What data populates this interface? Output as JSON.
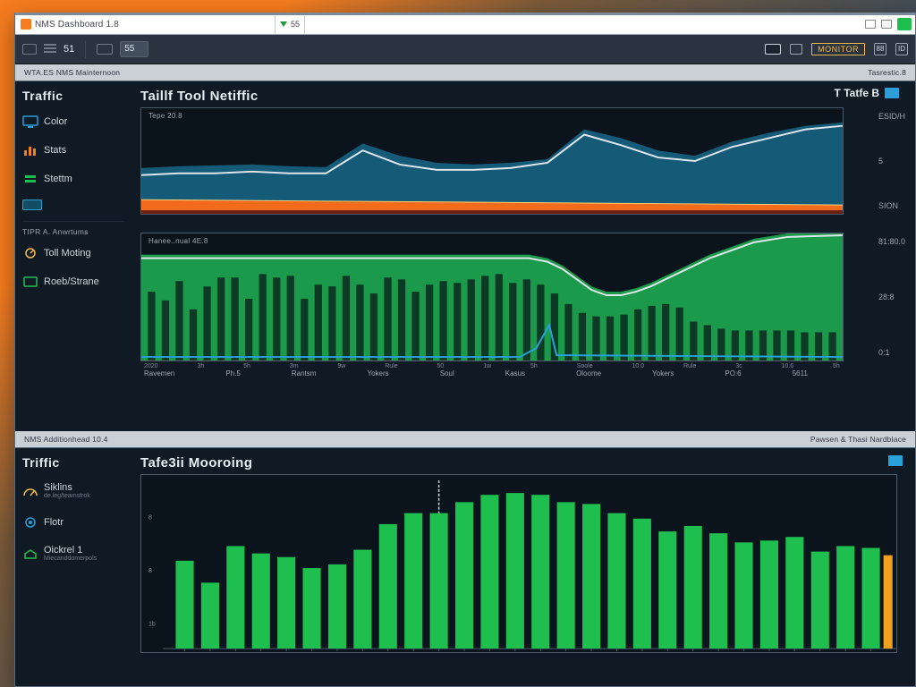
{
  "window": {
    "title": "NMS Dashboard 1.8",
    "tool_badge": "55",
    "url_value": "51",
    "right_badge_text": "MONITOR",
    "right_box_a": "88",
    "right_box_b": "ID"
  },
  "strip_top": {
    "left_label": "WTA.ES NMS Mainternoon",
    "right_label": "Tasrestic.8"
  },
  "strip_mid": {
    "left_label": "NMS Additionhead 10.4",
    "right_label": "Pawsen & Thasi Nardblace"
  },
  "panel_a": {
    "sidebar_title": "Traffic",
    "nav": [
      {
        "icon": "monitor-icon",
        "color": "#2aa0d8",
        "label": "Color"
      },
      {
        "icon": "stats-icon",
        "color": "#f57c1f",
        "label": "Stats"
      },
      {
        "icon": "settings-icon",
        "color": "#1fbf4f",
        "label": "Stettm"
      }
    ],
    "section_label": "TIPR A. Anwrtums",
    "nav2": [
      {
        "icon": "tool-icon",
        "color": "#f2b84b",
        "label": "Toll Moting"
      },
      {
        "icon": "stream-icon",
        "color": "#1fbf4f",
        "label": "Roeb/Strane"
      }
    ],
    "content_title": "Taillf Tool Netiffic",
    "corner_title": "T Tatfe B",
    "chart_a": {
      "subtitle_left": "Tepe 20.8",
      "ylabel_hi": "ESID/H",
      "ylabel_mid": "5",
      "ylabel_lo": "SION"
    },
    "chart_b": {
      "subtitle_left": "Hanee..nual 4E.8",
      "ylabel_hi": "81:80.0",
      "ylabel_mid": "28:8",
      "ylabel_lo": "0:1"
    },
    "x_ticks": [
      "2020",
      "3h",
      "5h",
      "3m",
      "9w",
      "Rule",
      "50",
      "1w",
      "5h",
      "Soole",
      "10.0",
      "Rule",
      "3c",
      "10.6",
      "5h"
    ],
    "x_groups": [
      "Ravemen",
      "Ph.5",
      "Rantsm",
      "Yokers",
      "Soul",
      "Kasus",
      "Oloome",
      "Yokers",
      "PO:6",
      "5611"
    ]
  },
  "panel_b": {
    "sidebar_title": "Triffic",
    "nav": [
      {
        "icon": "gauge-icon",
        "color": "#f2b84b",
        "label": "Siklins",
        "sub": "de.leg/teamstrok"
      },
      {
        "icon": "target-icon",
        "color": "#2aa0d8",
        "label": "Flotr"
      },
      {
        "icon": "home-icon",
        "color": "#1fbf4f",
        "label": "Oickrel 1",
        "sub": "Miecanddomerpols"
      }
    ],
    "content_title": "Tafe3ii Mooroing",
    "y_ticks": [
      "8",
      "8",
      "1b"
    ]
  },
  "chart_data": [
    {
      "type": "area",
      "title": "Taillf Tool Netiffic — upper area",
      "x": [
        0,
        1,
        2,
        3,
        4,
        5,
        6,
        7,
        8,
        9,
        10,
        11,
        12,
        13,
        14,
        15,
        16,
        17,
        18,
        19
      ],
      "series": [
        {
          "name": "blue-area",
          "color": "#1a6f8e",
          "values": [
            52,
            54,
            55,
            56,
            54,
            53,
            80,
            66,
            58,
            56,
            58,
            62,
            96,
            86,
            72,
            66,
            82,
            92,
            100,
            104
          ]
        },
        {
          "name": "white-line",
          "color": "#dfe6ec",
          "values": [
            44,
            46,
            46,
            48,
            46,
            46,
            72,
            56,
            50,
            50,
            52,
            58,
            90,
            78,
            64,
            60,
            76,
            86,
            96,
            100
          ]
        },
        {
          "name": "orange-strip",
          "color": "#f57c1f",
          "values": [
            16,
            16,
            16,
            16,
            16,
            16,
            16,
            16,
            14,
            14,
            14,
            14,
            12,
            12,
            12,
            12,
            10,
            10,
            10,
            10
          ]
        }
      ],
      "ylim": [
        0,
        120
      ]
    },
    {
      "type": "area",
      "title": "Taillf Tool Netiffic — lower green+bars",
      "x": [
        0,
        1,
        2,
        3,
        4,
        5,
        6,
        7,
        8,
        9,
        10,
        11,
        12,
        13,
        14,
        15,
        16,
        17,
        18,
        19,
        20,
        21,
        22,
        23,
        24,
        25,
        26,
        27,
        28,
        29,
        30,
        31,
        32,
        33,
        34,
        35,
        36,
        37,
        38,
        39,
        40,
        41,
        42,
        43,
        44,
        45,
        46,
        47,
        48,
        49
      ],
      "series": [
        {
          "name": "green-area",
          "color": "#1fae55",
          "values": [
            120,
            120,
            120,
            120,
            120,
            120,
            120,
            120,
            120,
            120,
            120,
            120,
            120,
            120,
            120,
            120,
            120,
            120,
            120,
            120,
            120,
            120,
            120,
            120,
            120,
            120,
            120,
            120,
            116,
            108,
            96,
            84,
            78,
            78,
            82,
            88,
            96,
            104,
            112,
            120,
            126,
            132,
            138,
            144,
            144,
            144,
            144,
            144,
            144,
            144
          ]
        },
        {
          "name": "white-line",
          "color": "#dfe6ec",
          "values": [
            116,
            116,
            116,
            116,
            116,
            116,
            116,
            116,
            116,
            116,
            116,
            116,
            116,
            116,
            116,
            116,
            116,
            116,
            116,
            116,
            116,
            116,
            116,
            116,
            116,
            116,
            116,
            116,
            112,
            104,
            92,
            80,
            74,
            74,
            78,
            84,
            92,
            100,
            108,
            116,
            122,
            128,
            134,
            142,
            142,
            142,
            142,
            142,
            142,
            142
          ]
        },
        {
          "name": "blue-line",
          "color": "#2aa0d8",
          "values": [
            4,
            4,
            4,
            4,
            4,
            4,
            4,
            4,
            4,
            4,
            4,
            4,
            4,
            4,
            4,
            4,
            4,
            4,
            4,
            4,
            4,
            4,
            4,
            4,
            4,
            4,
            4,
            2,
            14,
            40,
            4,
            4,
            4,
            4,
            4,
            4,
            4,
            4,
            4,
            4,
            4,
            4,
            4,
            4,
            4,
            4,
            4,
            4,
            4,
            4
          ]
        }
      ],
      "bars": {
        "name": "tick-bars",
        "color": "#0c3a24",
        "values": [
          78,
          68,
          90,
          58,
          84,
          94,
          94,
          70,
          98,
          94,
          96,
          70,
          86,
          84,
          96,
          86,
          76,
          94,
          92,
          78,
          86,
          90,
          88,
          92,
          96,
          98,
          88,
          92,
          86,
          76,
          64,
          54,
          50,
          50,
          52,
          58,
          62,
          64,
          60,
          44,
          40,
          36,
          34,
          34,
          34,
          34,
          34,
          32,
          32,
          32
        ]
      },
      "ylim": [
        0,
        144
      ]
    },
    {
      "type": "bar",
      "title": "Tafe3ii Mooroing",
      "categories": [
        "1",
        "2",
        "3",
        "4",
        "5",
        "6",
        "7",
        "8",
        "9",
        "10",
        "11",
        "12",
        "13",
        "14",
        "15",
        "16",
        "17",
        "18",
        "19",
        "20",
        "21",
        "22",
        "23",
        "24",
        "25",
        "26",
        "27",
        "28"
      ],
      "series": [
        {
          "name": "green-bars",
          "color": "#1fbf4f",
          "values": [
            96,
            72,
            112,
            104,
            100,
            88,
            92,
            108,
            136,
            148,
            148,
            160,
            168,
            170,
            168,
            160,
            158,
            148,
            142,
            128,
            134,
            126,
            116,
            118,
            122,
            106,
            112,
            110
          ]
        },
        {
          "name": "orange-bars",
          "color": "#f2a11f",
          "values": [
            0,
            0,
            0,
            0,
            0,
            0,
            0,
            0,
            0,
            0,
            0,
            0,
            0,
            0,
            0,
            0,
            0,
            0,
            0,
            0,
            0,
            0,
            0,
            0,
            0,
            0,
            0,
            102
          ]
        }
      ],
      "ylim": [
        0,
        180
      ],
      "cursor_index": 10
    }
  ]
}
